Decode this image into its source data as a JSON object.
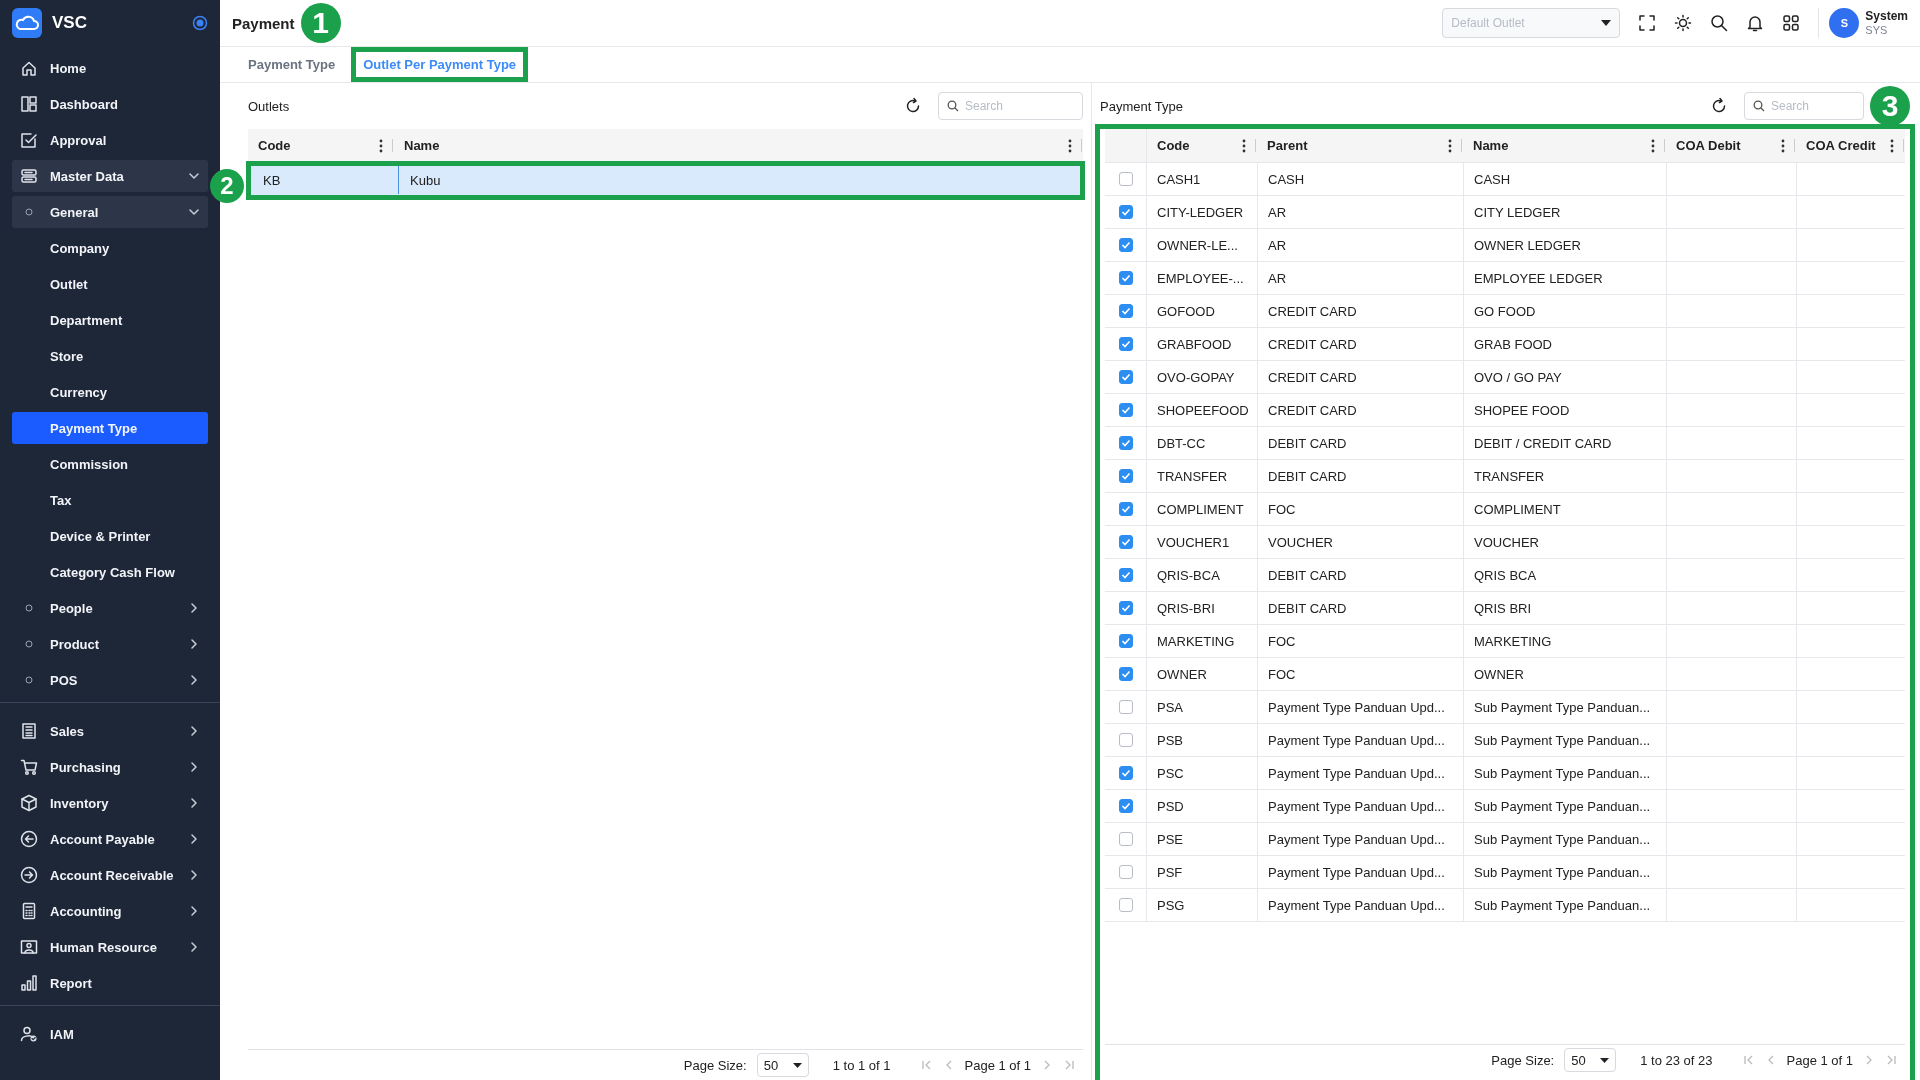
{
  "sidebar": {
    "brand": "VSC",
    "sections": [
      {
        "items": [
          {
            "label": "Home",
            "selected": false
          },
          {
            "label": "Dashboard",
            "selected": false
          },
          {
            "label": "Approval",
            "selected": false
          },
          {
            "label": "Master Data",
            "selected": false,
            "expanded": true,
            "children": [
              {
                "label": "General",
                "selected": false,
                "expanded": true,
                "children": [
                  {
                    "label": "Company",
                    "selected": false
                  },
                  {
                    "label": "Outlet",
                    "selected": false
                  },
                  {
                    "label": "Department",
                    "selected": false
                  },
                  {
                    "label": "Store",
                    "selected": false
                  },
                  {
                    "label": "Currency",
                    "selected": false
                  },
                  {
                    "label": "Payment Type",
                    "selected": true
                  },
                  {
                    "label": "Commission",
                    "selected": false
                  },
                  {
                    "label": "Tax",
                    "selected": false
                  },
                  {
                    "label": "Device & Printer",
                    "selected": false
                  },
                  {
                    "label": "Category Cash Flow",
                    "selected": false
                  }
                ]
              },
              {
                "label": "People",
                "selected": false,
                "expanded": false
              },
              {
                "label": "Product",
                "selected": false,
                "expanded": false
              },
              {
                "label": "POS",
                "selected": false,
                "expanded": false
              }
            ]
          }
        ]
      },
      {
        "items": [
          {
            "label": "Sales",
            "selected": false,
            "expanded": false
          },
          {
            "label": "Purchasing",
            "selected": false,
            "expanded": false
          },
          {
            "label": "Inventory",
            "selected": false,
            "expanded": false
          },
          {
            "label": "Account Payable",
            "selected": false,
            "expanded": false
          },
          {
            "label": "Account Receivable",
            "selected": false,
            "expanded": false
          },
          {
            "label": "Accounting",
            "selected": false,
            "expanded": false
          },
          {
            "label": "Human Resource",
            "selected": false,
            "expanded": false
          },
          {
            "label": "Report",
            "selected": false
          }
        ]
      },
      {
        "items": [
          {
            "label": "IAM",
            "selected": false
          }
        ]
      }
    ]
  },
  "header": {
    "title": "Payment",
    "outlet_select": {
      "placeholder": "Default Outlet"
    },
    "user": {
      "initial": "S",
      "name": "System",
      "code": "SYS"
    }
  },
  "tabs": [
    {
      "label": "Payment Type",
      "selected": false
    },
    {
      "label": "Outlet Per Payment Type",
      "selected": true,
      "callout": "1"
    }
  ],
  "outlets": {
    "title": "Outlets",
    "search": {
      "placeholder": "Search"
    },
    "columns": [
      "Code",
      "Name"
    ],
    "rows": [
      {
        "cells": [
          "KB",
          "Kubu"
        ],
        "selected": true,
        "callout": "2"
      }
    ],
    "pagination": {
      "page_size_label": "Page Size:",
      "page_size": "50",
      "range": "1 to 1 of 1",
      "page": "Page 1 of 1"
    }
  },
  "payment_types": {
    "title": "Payment Type",
    "search": {
      "placeholder": "Search"
    },
    "callout": "3",
    "columns": [
      "Code",
      "Parent",
      "Name",
      "COA Debit",
      "COA Credit"
    ],
    "rows": [
      {
        "checked": false,
        "cells": [
          "CASH1",
          "CASH",
          "CASH"
        ]
      },
      {
        "checked": true,
        "cells": [
          "CITY-LEDGER",
          "AR",
          "CITY LEDGER"
        ]
      },
      {
        "checked": true,
        "cells": [
          "OWNER-LE...",
          "AR",
          "OWNER LEDGER"
        ]
      },
      {
        "checked": true,
        "cells": [
          "EMPLOYEE-...",
          "AR",
          "EMPLOYEE LEDGER"
        ]
      },
      {
        "checked": true,
        "cells": [
          "GOFOOD",
          "CREDIT CARD",
          "GO FOOD"
        ]
      },
      {
        "checked": true,
        "cells": [
          "GRABFOOD",
          "CREDIT CARD",
          "GRAB FOOD"
        ]
      },
      {
        "checked": true,
        "cells": [
          "OVO-GOPAY",
          "CREDIT CARD",
          "OVO / GO PAY"
        ]
      },
      {
        "checked": true,
        "cells": [
          "SHOPEEFOOD",
          "CREDIT CARD",
          "SHOPEE FOOD"
        ]
      },
      {
        "checked": true,
        "cells": [
          "DBT-CC",
          "DEBIT CARD",
          "DEBIT / CREDIT CARD"
        ]
      },
      {
        "checked": true,
        "cells": [
          "TRANSFER",
          "DEBIT CARD",
          "TRANSFER"
        ]
      },
      {
        "checked": true,
        "cells": [
          "COMPLIMENT",
          "FOC",
          "COMPLIMENT"
        ]
      },
      {
        "checked": true,
        "cells": [
          "VOUCHER1",
          "VOUCHER",
          "VOUCHER"
        ]
      },
      {
        "checked": true,
        "cells": [
          "QRIS-BCA",
          "DEBIT CARD",
          "QRIS BCA"
        ]
      },
      {
        "checked": true,
        "cells": [
          "QRIS-BRI",
          "DEBIT CARD",
          "QRIS BRI"
        ]
      },
      {
        "checked": true,
        "cells": [
          "MARKETING",
          "FOC",
          "MARKETING"
        ]
      },
      {
        "checked": true,
        "cells": [
          "OWNER",
          "FOC",
          "OWNER"
        ]
      },
      {
        "checked": false,
        "cells": [
          "PSA",
          "Payment Type Panduan Upd...",
          "Sub Payment Type Panduan..."
        ]
      },
      {
        "checked": false,
        "cells": [
          "PSB",
          "Payment Type Panduan Upd...",
          "Sub Payment Type Panduan..."
        ]
      },
      {
        "checked": true,
        "cells": [
          "PSC",
          "Payment Type Panduan Upd...",
          "Sub Payment Type Panduan..."
        ]
      },
      {
        "checked": true,
        "cells": [
          "PSD",
          "Payment Type Panduan Upd...",
          "Sub Payment Type Panduan..."
        ]
      },
      {
        "checked": false,
        "cells": [
          "PSE",
          "Payment Type Panduan Upd...",
          "Sub Payment Type Panduan..."
        ]
      },
      {
        "checked": false,
        "cells": [
          "PSF",
          "Payment Type Panduan Upd...",
          "Sub Payment Type Panduan..."
        ]
      },
      {
        "checked": false,
        "cells": [
          "PSG",
          "Payment Type Panduan Upd...",
          "Sub Payment Type Panduan..."
        ]
      }
    ],
    "pagination": {
      "page_size_label": "Page Size:",
      "page_size": "50",
      "range": "1 to 23 of 23",
      "page": "Page 1 of 1"
    }
  }
}
